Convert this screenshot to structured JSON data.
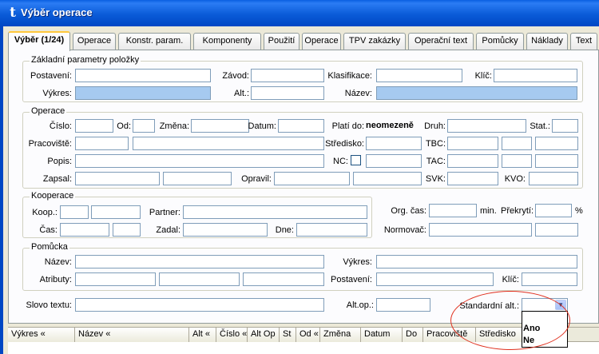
{
  "window": {
    "title": "Výběr operace",
    "app_icon_glyph": "t"
  },
  "tabs": [
    {
      "label": "Výběr (1/24)",
      "active": true
    },
    {
      "label": "Operace"
    },
    {
      "label": "Konstr. param."
    },
    {
      "label": "Komponenty"
    },
    {
      "label": "Použití"
    },
    {
      "label": "Operace"
    },
    {
      "label": "TPV zakázky"
    },
    {
      "label": "Operační text"
    },
    {
      "label": "Pomůcky"
    },
    {
      "label": "Náklady"
    },
    {
      "label": "Text"
    }
  ],
  "zakladni": {
    "legend": "Základní parametry položky",
    "postaveni": "Postavení:",
    "zavod": "Závod:",
    "klasifikace": "Klasifikace:",
    "klic": "Klíč:",
    "vykres": "Výkres:",
    "alt": "Alt.:",
    "nazev": "Název:"
  },
  "operace": {
    "legend": "Operace",
    "cislo": "Číslo:",
    "od": "Od:",
    "zmena": "Změna:",
    "datum": "Datum:",
    "plati_do": "Platí do:",
    "plati_do_value": "neomezeně",
    "druh": "Druh:",
    "stat": "Stat.:",
    "pracoviste": "Pracoviště:",
    "stredisko": "Středisko:",
    "tbc": "TBC:",
    "popis": "Popis:",
    "nc": "NC:",
    "tac": "TAC:",
    "zapsal": "Zapsal:",
    "opravil": "Opravil:",
    "svk": "SVK:",
    "kvo": "KVO:"
  },
  "kooperace": {
    "legend": "Kooperace",
    "koop": "Koop.:",
    "partner": "Partner:",
    "cas": "Čas:",
    "zadal": "Zadal:",
    "dne": "Dne:"
  },
  "casy": {
    "org_cas": "Org. čas:",
    "min": "min.",
    "prekryti": "Překrytí:",
    "percent": "%",
    "normovac": "Normovač:"
  },
  "pomucka": {
    "legend": "Pomůcka",
    "nazev": "Název:",
    "vykres": "Výkres:",
    "atributy": "Atributy:",
    "postaveni": "Postavení:",
    "klic": "Klíč:"
  },
  "bottom": {
    "slovo_textu": "Slovo textu:",
    "alt_op": "Alt.op.:",
    "standardni_alt": "Standardní alt.:",
    "standardni_alt_value": ""
  },
  "dropdown_options": [
    "Ano",
    "Ne"
  ],
  "grid_columns": [
    "Výkres «",
    "Název «",
    "Alt «",
    "Číslo «",
    "Alt Op",
    "St",
    "Od «",
    "Změna",
    "Datum",
    "Do",
    "Pracoviště",
    "Středisko"
  ],
  "colors": {
    "required_field": "#a6caf0",
    "annotation": "#e0301e",
    "tab_highlight": "#ffc83c"
  }
}
